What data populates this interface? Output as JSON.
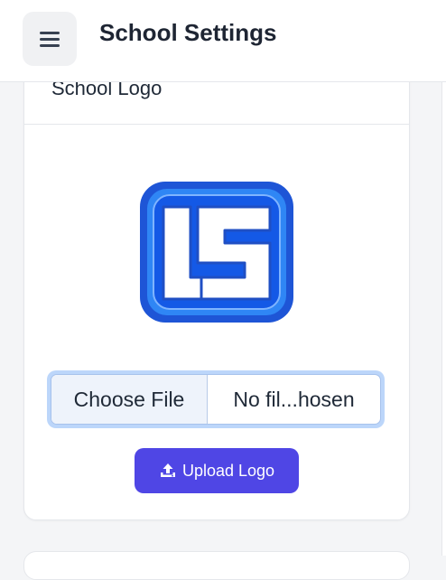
{
  "header": {
    "title": "School Settings",
    "menu_icon": "hamburger-menu-icon"
  },
  "logo_card": {
    "title": "School Logo",
    "logo_text": "LS",
    "file_input": {
      "button_label": "Choose File",
      "file_name": "No fil...hosen"
    },
    "upload_button": {
      "label": "Upload Logo",
      "icon": "upload-icon"
    }
  },
  "colors": {
    "accent": "#4f46e5",
    "logo_blue": "#1565e8",
    "logo_outer": "#1e55d6"
  }
}
